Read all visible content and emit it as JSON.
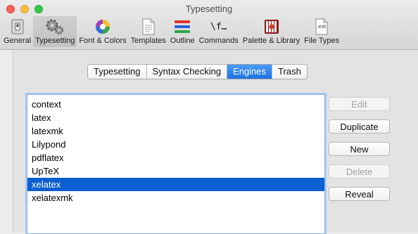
{
  "window": {
    "title": "Typesetting"
  },
  "toolbar": {
    "items": [
      {
        "label": "General",
        "icon": "general-icon"
      },
      {
        "label": "Typesetting",
        "icon": "gears-icon",
        "selected": true
      },
      {
        "label": "Font & Colors",
        "icon": "color-wheel-icon"
      },
      {
        "label": "Templates",
        "icon": "document-icon"
      },
      {
        "label": "Outline",
        "icon": "outline-icon"
      },
      {
        "label": "Commands",
        "icon": "commands-icon",
        "glyph": "\\f…"
      },
      {
        "label": "Palette & Library",
        "icon": "palette-library-icon"
      },
      {
        "label": "File Types",
        "icon": "file-ext-icon",
        "glyph": ".ext"
      }
    ]
  },
  "tabs": [
    {
      "label": "Typesetting"
    },
    {
      "label": "Syntax Checking"
    },
    {
      "label": "Engines",
      "active": true
    },
    {
      "label": "Trash"
    }
  ],
  "engines": [
    "context",
    "latex",
    "latexmk",
    "Lilypond",
    "pdflatex",
    "UpTeX",
    "xelatex",
    "xelatexmk"
  ],
  "selected_engine": "xelatex",
  "buttons": {
    "edit": "Edit",
    "duplicate": "Duplicate",
    "new": "New",
    "delete": "Delete",
    "reveal": "Reveal"
  },
  "colors": {
    "selection": "#0b5fd0",
    "accent": "#1a73e3"
  }
}
